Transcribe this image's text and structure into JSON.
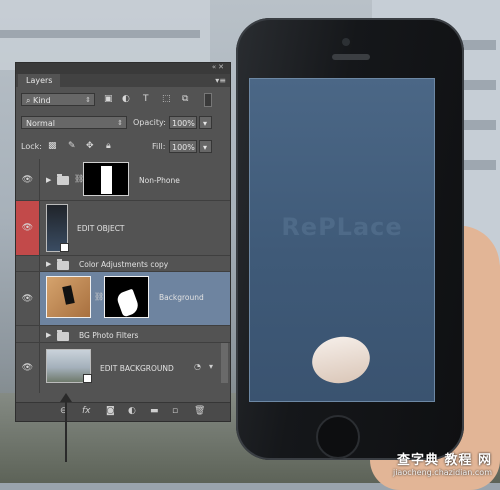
{
  "panel": {
    "tab_label": "Layers",
    "filter_kind": "Kind",
    "blend_mode": "Normal",
    "opacity_label": "Opacity:",
    "opacity_value": "100%",
    "lock_label": "Lock:",
    "fill_label": "Fill:",
    "fill_value": "100%",
    "layers": [
      {
        "name": "Non-Phone",
        "type": "group"
      },
      {
        "name": "EDIT OBJECT",
        "type": "smart-object"
      },
      {
        "name": "Color Adjustments copy",
        "type": "group-collapsed"
      },
      {
        "name": "Background",
        "type": "masked",
        "selected": true
      },
      {
        "name": "BG Photo Filters",
        "type": "group-collapsed"
      },
      {
        "name": "EDIT BACKGROUND",
        "type": "smart-object"
      }
    ],
    "footer_icons": [
      "link-icon",
      "fx-icon",
      "mask-icon",
      "adjustment-icon",
      "folder-icon",
      "new-layer-icon",
      "trash-icon"
    ]
  },
  "phone": {
    "screen_text": "RePLace",
    "screen_color": "#3f5a78"
  },
  "watermark": {
    "title": "查字典 教程 网",
    "subtitle": "jiaocheng.chazidian.com"
  },
  "colors": {
    "selected_row": "#6e84a0",
    "edit_object_eye": "#c24a4a",
    "panel_bg": "#535353"
  }
}
